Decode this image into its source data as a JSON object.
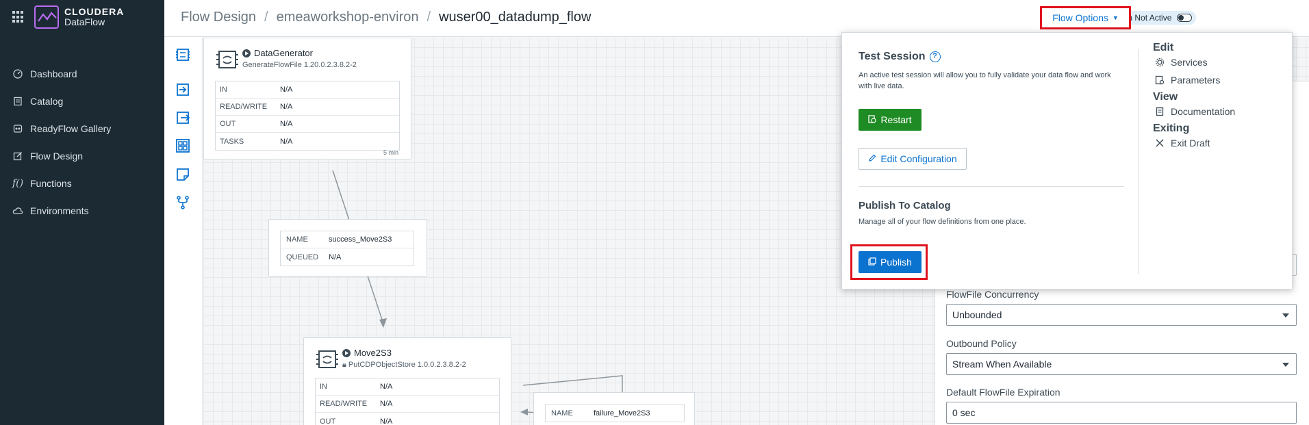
{
  "brand": {
    "line1": "CLOUDERA",
    "line2": "DataFlow",
    "accent": "#b96cf0"
  },
  "sidebar": {
    "items": [
      {
        "label": "Dashboard",
        "icon": "gauge-icon"
      },
      {
        "label": "Catalog",
        "icon": "catalog-icon"
      },
      {
        "label": "ReadyFlow Gallery",
        "icon": "readyflow-icon"
      },
      {
        "label": "Flow Design",
        "icon": "edit-icon"
      },
      {
        "label": "Functions",
        "icon": "function-icon"
      },
      {
        "label": "Environments",
        "icon": "cloud-icon"
      }
    ]
  },
  "header": {
    "breadcrumb": [
      "Flow Design",
      "emeaworkshop-environ",
      "wuser00_datadump_flow"
    ],
    "test_session_badge": "Test Session Not Active",
    "flow_options_label": "Flow Options"
  },
  "canvas": {
    "processors": [
      {
        "name": "DataGenerator",
        "type": "GenerateFlowFile 1.20.0.2.3.8.2-2",
        "rows": [
          [
            "IN",
            "N/A"
          ],
          [
            "READ/WRITE",
            "N/A"
          ],
          [
            "OUT",
            "N/A"
          ],
          [
            "TASKS",
            "N/A"
          ]
        ],
        "time": "5 min"
      },
      {
        "name": "Move2S3",
        "type": "PutCDPObjectStore 1.0.0.2.3.8.2-2",
        "rows": [
          [
            "IN",
            "N/A"
          ],
          [
            "READ/WRITE",
            "N/A"
          ],
          [
            "OUT",
            "N/A"
          ]
        ]
      }
    ],
    "connections": [
      {
        "rows": [
          [
            "NAME",
            "success_Move2S3"
          ],
          [
            "QUEUED",
            "N/A"
          ]
        ]
      },
      {
        "rows": [
          [
            "NAME",
            "failure_Move2S3"
          ]
        ]
      }
    ]
  },
  "settings": {
    "concurrency_label": "FlowFile Concurrency",
    "concurrency_value": "Unbounded",
    "outbound_label": "Outbound Policy",
    "outbound_value": "Stream When Available",
    "expiration_label": "Default FlowFile Expiration",
    "expiration_value": "0 sec"
  },
  "menu": {
    "test_session_title": "Test Session",
    "test_session_desc": "An active test session will allow you to fully validate your data flow and work with live data.",
    "restart_label": "Restart",
    "edit_config_label": "Edit Configuration",
    "publish_title": "Publish To Catalog",
    "publish_desc": "Manage all of your flow definitions from one place.",
    "publish_label": "Publish",
    "edit_heading": "Edit",
    "services_label": "Services",
    "parameters_label": "Parameters",
    "view_heading": "View",
    "documentation_label": "Documentation",
    "exiting_heading": "Exiting",
    "exit_draft_label": "Exit Draft"
  },
  "colors": {
    "primary": "#0a72cf",
    "success": "#1f8b24",
    "highlight": "#e0131d",
    "sidebar": "#1c2a33"
  }
}
